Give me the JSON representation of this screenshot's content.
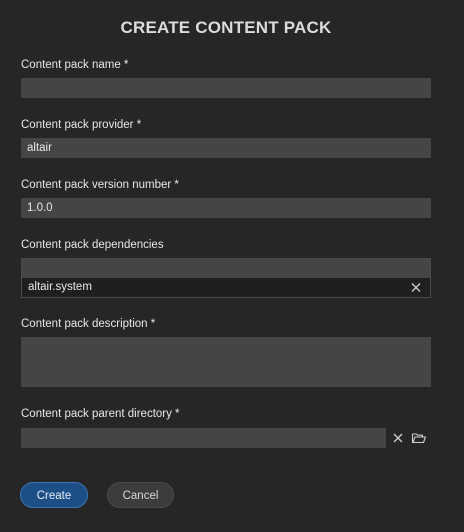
{
  "dialog": {
    "title": "CREATE CONTENT PACK"
  },
  "fields": {
    "name": {
      "label": "Content pack name *",
      "value": ""
    },
    "provider": {
      "label": "Content pack provider *",
      "value": "altair"
    },
    "version": {
      "label": "Content pack version number *",
      "value": "1.0.0"
    },
    "dependencies": {
      "label": "Content pack dependencies",
      "value": "",
      "tags": [
        "altair.system"
      ]
    },
    "description": {
      "label": "Content pack description *",
      "value": ""
    },
    "parent_directory": {
      "label": "Content pack parent directory *",
      "value": ""
    }
  },
  "icons": {
    "tag_remove": "close-icon",
    "clear": "close-icon",
    "browse": "folder-open-icon"
  },
  "buttons": {
    "create": "Create",
    "cancel": "Cancel"
  },
  "colors": {
    "background": "#262626",
    "field": "#454545",
    "primary": "#1d4f86",
    "secondary": "#3c3c3c"
  }
}
